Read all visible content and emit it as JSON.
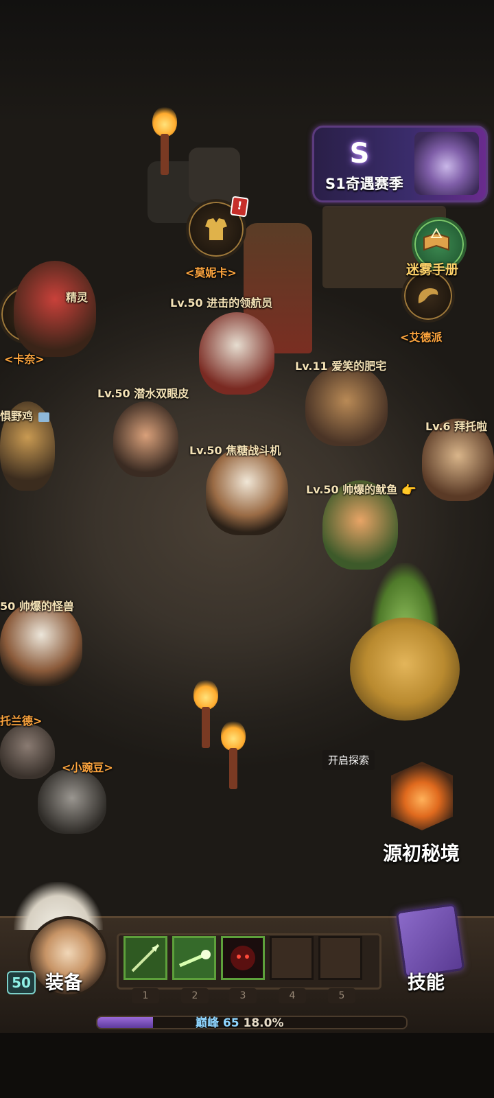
{
  "season_banner": {
    "title": "S1奇遇赛季",
    "logo": "S"
  },
  "misty_handbook": {
    "label": "迷雾手册"
  },
  "npcs": {
    "monica": "<莫妮卡>",
    "kana": "<卡奈>",
    "elder": "<艾德派",
    "peas": "<小豌豆>",
    "toland": "托兰德>"
  },
  "players": [
    {
      "level_name": "Lv.50 进击的领航员"
    },
    {
      "level_name": "Lv.50 潜水双眼皮"
    },
    {
      "level_name": "Lv.11 爱笑的肥宅"
    },
    {
      "level_name": "Lv.6 拜托啦"
    },
    {
      "level_name": "Lv.50 焦糖战斗机"
    },
    {
      "level_name": "Lv.50 帅爆的鱿鱼"
    },
    {
      "level_name": "50 帅爆的怪兽"
    },
    {
      "level_name": "精灵"
    },
    {
      "level_name": "惧野鸡"
    }
  ],
  "explore": {
    "tip": "开启探索",
    "label": "源初秘境"
  },
  "hud": {
    "level": "50",
    "equip_label": "装备",
    "skills_label": "技能",
    "slot_numbers": [
      "1",
      "2",
      "3",
      "4",
      "5"
    ],
    "xp_peak": "巅峰 65",
    "xp_percent": "18.0%",
    "xp_fraction": 0.18
  },
  "icons": {
    "alert": "!",
    "hand": "👉"
  }
}
